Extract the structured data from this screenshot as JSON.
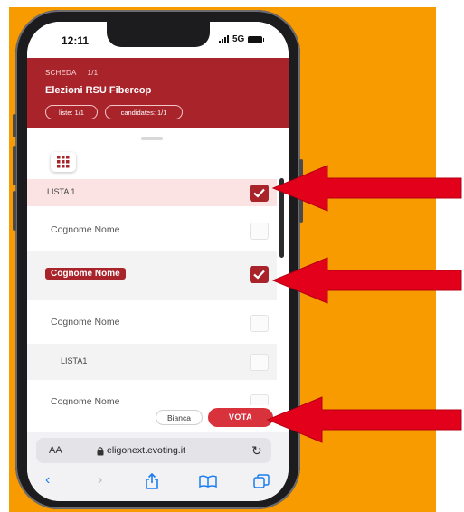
{
  "status_bar": {
    "time": "12:11",
    "network": "5G"
  },
  "header": {
    "scheda_label": "SCHEDA",
    "scheda_count": "1/1",
    "title": "Elezioni RSU Fibercop",
    "pill_liste": "liste: 1/1",
    "pill_candidates": "candidates: 1/1"
  },
  "rows": [
    {
      "label": "LISTA 1",
      "checked": true
    },
    {
      "label": "Cognome Nome",
      "checked": false
    },
    {
      "label": "Cognome Nome",
      "checked": true,
      "highlighted": true
    },
    {
      "label": "Cognome Nome",
      "checked": false
    },
    {
      "label": "LISTA1",
      "checked": false
    },
    {
      "label": "Cognome Nome",
      "checked": false
    }
  ],
  "actions": {
    "blank_label": "Bianca",
    "vote_label": "VOTA"
  },
  "browser": {
    "aa_label": "AA",
    "url": "eligonext.evoting.it"
  },
  "colors": {
    "accent": "#a9232b",
    "vote": "#d8323c",
    "arrow": "#e3001b",
    "background": "#f89b00"
  }
}
